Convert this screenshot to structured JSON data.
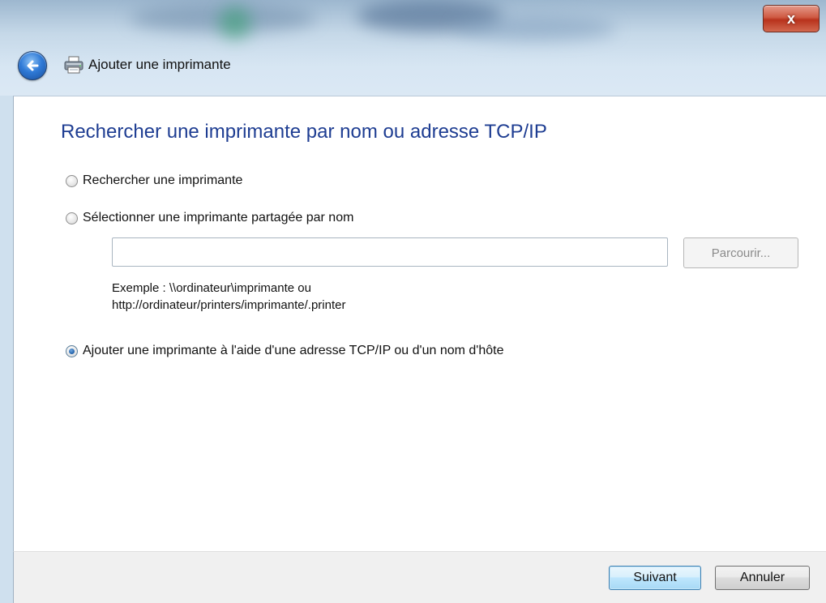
{
  "window": {
    "title": "Ajouter une imprimante",
    "close_label": "x"
  },
  "page": {
    "heading": "Rechercher une imprimante par nom ou adresse TCP/IP",
    "options": [
      {
        "label": "Rechercher une imprimante",
        "selected": false
      },
      {
        "label": "Sélectionner une imprimante partagée par nom",
        "selected": false
      },
      {
        "label": "Ajouter une imprimante à l'aide d'une adresse TCP/IP ou d'un nom d'hôte",
        "selected": true
      }
    ],
    "share_input": {
      "value": "",
      "placeholder": ""
    },
    "browse_label": "Parcourir...",
    "example_line1": "Exemple : \\\\ordinateur\\imprimante ou",
    "example_line2": "http://ordinateur/printers/imprimante/.printer"
  },
  "footer": {
    "next_label": "Suivant",
    "cancel_label": "Annuler"
  },
  "colors": {
    "heading": "#1e3d92",
    "accent": "#3c7fb1"
  }
}
